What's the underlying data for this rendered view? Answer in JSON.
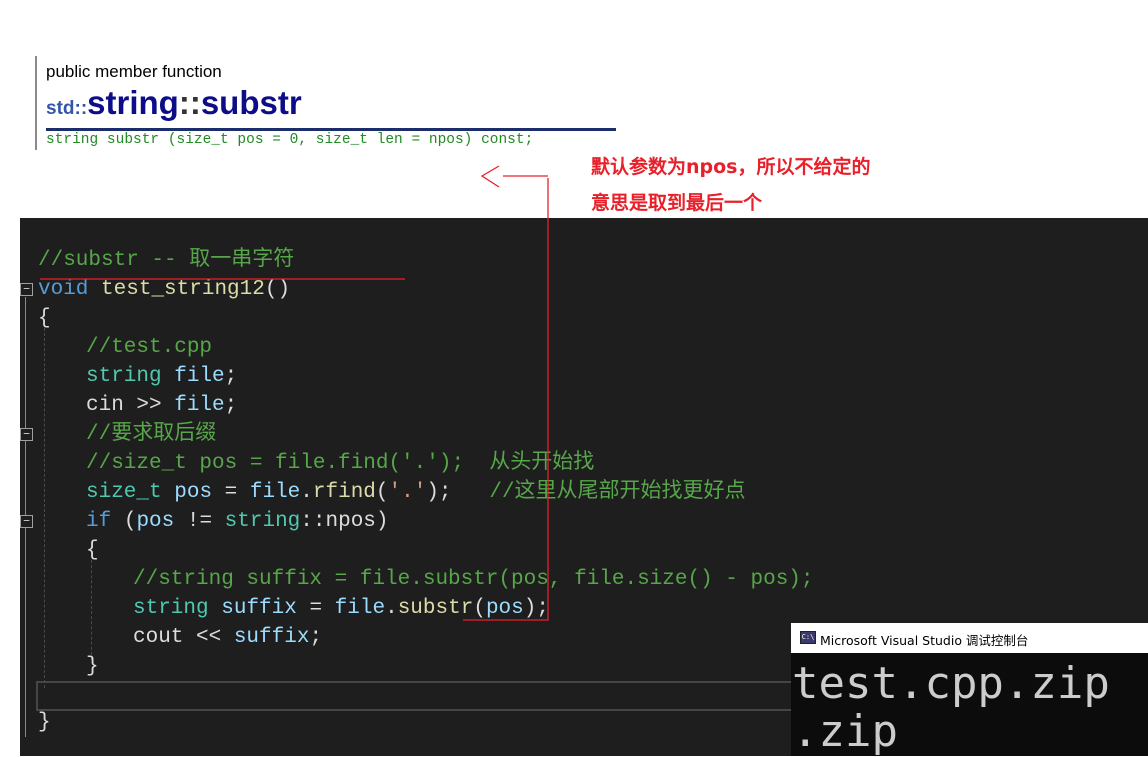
{
  "reference": {
    "label": "public member function",
    "ns": "std::",
    "name": "string",
    "sep": "::",
    "func": "substr",
    "signature": "string substr (size_t pos = 0, size_t len = npos) const;"
  },
  "annotation": {
    "line1": "默认参数为npos，所以不给定的",
    "line2": "意思是取到最后一个"
  },
  "code_lines": {
    "l1": "//substr -- 取一串字符",
    "l2_kw": "void",
    "l2_fn": "test_string12",
    "l2_rest": "()",
    "l3": "{",
    "l4": "//test.cpp",
    "l5_ty": "string",
    "l5_var": "file",
    "l5_rest": ";",
    "l6_a": "cin >> ",
    "l6_var": "file",
    "l6_rest": ";",
    "l7": "//要求取后缀",
    "l8": "//size_t pos = file.find('.');  从头开始找",
    "l9_ty": "size_t",
    "l9_var": "pos",
    "l9_eq": " = ",
    "l9_var2": "file",
    "l9_dot": ".",
    "l9_fn": "rfind",
    "l9_open": "(",
    "l9_str": "'.'",
    "l9_close": ");   ",
    "l9_cm": "//这里从尾部开始找更好点",
    "l10_kw": "if",
    "l10_a": " (",
    "l10_var": "pos",
    "l10_b": " != ",
    "l10_ty": "string",
    "l10_c": "::npos)",
    "l11": "{",
    "l12": "//string suffix = file.substr(pos, file.size() - pos);",
    "l13_ty": "string",
    "l13_var": "suffix",
    "l13_eq": " = ",
    "l13_var2": "file",
    "l13_dot": ".",
    "l13_fn": "substr",
    "l13_open": "(",
    "l13_var3": "pos",
    "l13_close": ");",
    "l14_a": "cout << ",
    "l14_var": "suffix",
    "l14_rest": ";",
    "l15": "}",
    "l17": "}"
  },
  "console": {
    "title": "Microsoft Visual Studio 调试控制台",
    "icon": "C:\\",
    "output": [
      "test.cpp.zip",
      ".zip"
    ]
  },
  "colors": {
    "annotation": "#e8202a",
    "editor_bg": "#1e1e1e",
    "comment": "#57a64a",
    "keyword": "#569cd6",
    "type": "#4ec9b0",
    "variable": "#9cdcfe",
    "function": "#dcdcaa",
    "string": "#d69d85"
  },
  "icons": [
    "fold-toggle-icon",
    "console-app-icon",
    "annotation-arrow-icon"
  ]
}
